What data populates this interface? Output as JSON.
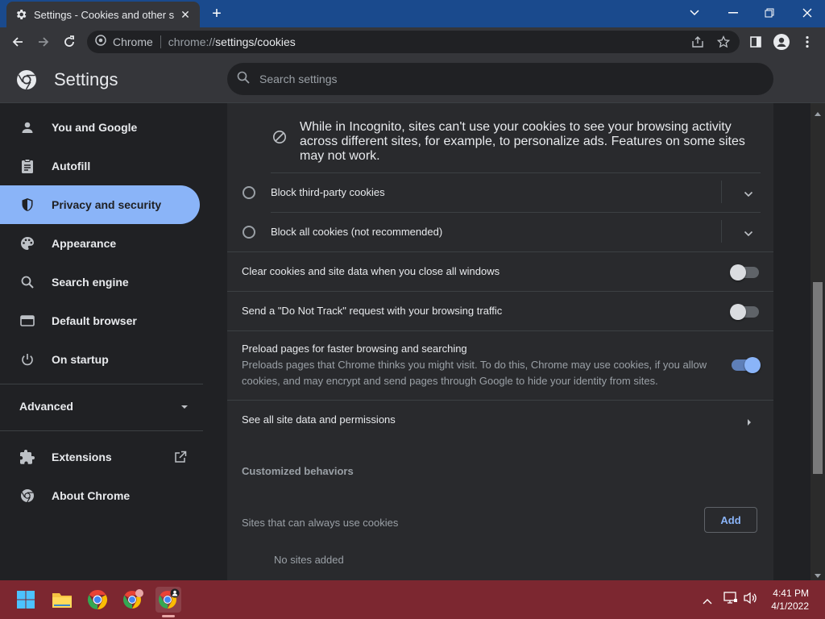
{
  "browser": {
    "tab_title": "Settings - Cookies and other site",
    "new_tab": "+",
    "site_label": "Chrome",
    "url_scheme": "chrome://",
    "url_path": "settings/cookies"
  },
  "settings": {
    "title": "Settings",
    "search_placeholder": "Search settings"
  },
  "sidebar": {
    "items": [
      {
        "label": "You and Google",
        "icon": "person-icon"
      },
      {
        "label": "Autofill",
        "icon": "clipboard-icon"
      },
      {
        "label": "Privacy and security",
        "icon": "shield-icon",
        "active": true
      },
      {
        "label": "Appearance",
        "icon": "palette-icon"
      },
      {
        "label": "Search engine",
        "icon": "search-icon"
      },
      {
        "label": "Default browser",
        "icon": "browser-icon"
      },
      {
        "label": "On startup",
        "icon": "power-icon"
      }
    ],
    "advanced": "Advanced",
    "extensions": "Extensions",
    "about": "About Chrome"
  },
  "content": {
    "incognito_note": "While in Incognito, sites can't use your cookies to see your browsing activity across different sites, for example, to personalize ads. Features on some sites may not work.",
    "block_third_party": "Block third-party cookies",
    "block_all": "Block all cookies (not recommended)",
    "clear_on_close": "Clear cookies and site data when you close all windows",
    "do_not_track": "Send a \"Do Not Track\" request with your browsing traffic",
    "preload_title": "Preload pages for faster browsing and searching",
    "preload_desc": "Preloads pages that Chrome thinks you might visit. To do this, Chrome may use cookies, if you allow cookies, and may encrypt and send pages through Google to hide your identity from sites.",
    "see_all": "See all site data and permissions",
    "customized_heading": "Customized behaviors",
    "always_use": "Sites that can always use cookies",
    "add_label": "Add",
    "no_sites": "No sites added"
  },
  "toggles": {
    "clear_on_close": false,
    "do_not_track": false,
    "preload": true
  },
  "taskbar": {
    "time": "4:41 PM",
    "date": "4/1/2022"
  },
  "colors": {
    "accent": "#8ab4f8",
    "titlebar": "#1a4a8d",
    "taskbar": "#7c2730"
  }
}
